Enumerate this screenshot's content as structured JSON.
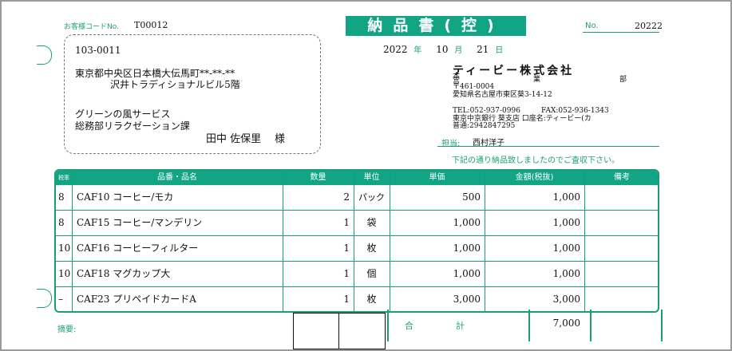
{
  "header": {
    "customer_code_label": "お客様コードNo.",
    "customer_code": "T00012",
    "title": "納品書(控)",
    "no_label": "No.",
    "no_value": "20222"
  },
  "address": {
    "postal": "103-0011",
    "line1": "東京都中央区日本橋大伝馬町**-**-**",
    "line2": "沢井トラディショナルビル5階",
    "company": "グリーンの風サービス",
    "dept": "総務部リラクゼーション課",
    "person": "田中 佐保里",
    "honorific": "様"
  },
  "date": {
    "year": "2022",
    "year_label": "年",
    "month": "10",
    "month_label": "月",
    "day": "21",
    "day_label": "日"
  },
  "issuer": {
    "name": "ティービー株式会社",
    "honsha": "本",
    "eigyo": "営",
    "gyo": "業",
    "bu": "部",
    "postal": "〒461-0004",
    "address": "愛知県名古屋市東区葵3-14-12",
    "tel": "TEL:052-937-0996",
    "fax": "FAX:052-936-1343",
    "bank": "東京中京銀行 葵支店 口座名:ティービー(カ",
    "account": "普通:2942847295"
  },
  "tanto": {
    "label": "担当:",
    "name": "西村洋子"
  },
  "notice": "下記の通り納品致しましたのでご査収下さい。",
  "table": {
    "headers": [
      "税率",
      "品番・品名",
      "数量",
      "単位",
      "単価",
      "金額(税抜)",
      "備考"
    ],
    "rows": [
      {
        "tax": "8",
        "name": "CAF10 コーヒー/モカ",
        "qty": "2",
        "unit": "パック",
        "price": "500",
        "amount": "1,000",
        "note": ""
      },
      {
        "tax": "8",
        "name": "CAF15 コーヒー/マンデリン",
        "qty": "1",
        "unit": "袋",
        "price": "1,000",
        "amount": "1,000",
        "note": ""
      },
      {
        "tax": "10",
        "name": "CAF16 コーヒーフィルター",
        "qty": "1",
        "unit": "枚",
        "price": "1,000",
        "amount": "1,000",
        "note": ""
      },
      {
        "tax": "10",
        "name": "CAF18 マグカップ大",
        "qty": "1",
        "unit": "個",
        "price": "1,000",
        "amount": "1,000",
        "note": ""
      },
      {
        "tax": "–",
        "name": "CAF23 プリペイドカードA",
        "qty": "1",
        "unit": "枚",
        "price": "3,000",
        "amount": "3,000",
        "note": ""
      }
    ]
  },
  "footer": {
    "tekiyo_label": "摘要:",
    "total_label_1": "合",
    "total_label_2": "計",
    "total_value": "7,000"
  },
  "colors": {
    "accent": "#11a586",
    "text": "#111111"
  }
}
